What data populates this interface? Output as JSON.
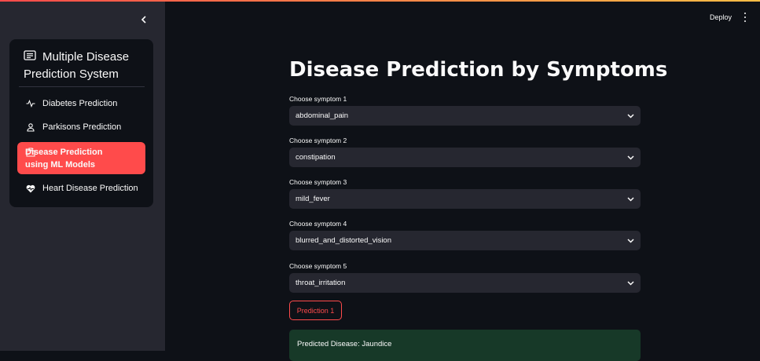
{
  "sidebar": {
    "collapse_icon": "chevron-left-icon",
    "menu_title": "Multiple Disease Prediction System",
    "menu_title_icon": "document-icon",
    "items": [
      {
        "label": "Diabetes Prediction",
        "icon": "activity-icon",
        "active": false
      },
      {
        "label": "Parkisons Prediction",
        "icon": "person-icon",
        "active": false
      },
      {
        "label": "Disease Prediction using ML Models",
        "icon": "hospital-icon",
        "active": true
      },
      {
        "label": "Heart Disease Prediction",
        "icon": "heart-pulse-icon",
        "active": false
      }
    ],
    "active_color": "#ff4b4b"
  },
  "header": {
    "deploy_label": "Deploy",
    "menu_icon": "more-vertical-icon"
  },
  "main": {
    "title": "Disease Prediction by Symptoms",
    "fields": [
      {
        "label": "Choose symptom 1",
        "value": "abdominal_pain"
      },
      {
        "label": "Choose symptom 2",
        "value": "constipation"
      },
      {
        "label": "Choose symptom 3",
        "value": "mild_fever"
      },
      {
        "label": "Choose symptom 4",
        "value": "blurred_and_distorted_vision"
      },
      {
        "label": "Choose symptom 5",
        "value": "throat_irritation"
      }
    ],
    "predict_button": "Prediction 1",
    "result": "Predicted Disease: Jaundice"
  },
  "colors": {
    "background": "#0e1117",
    "sidebar": "#262730",
    "accent": "#ff4b4b",
    "success_bg": "#173928"
  }
}
